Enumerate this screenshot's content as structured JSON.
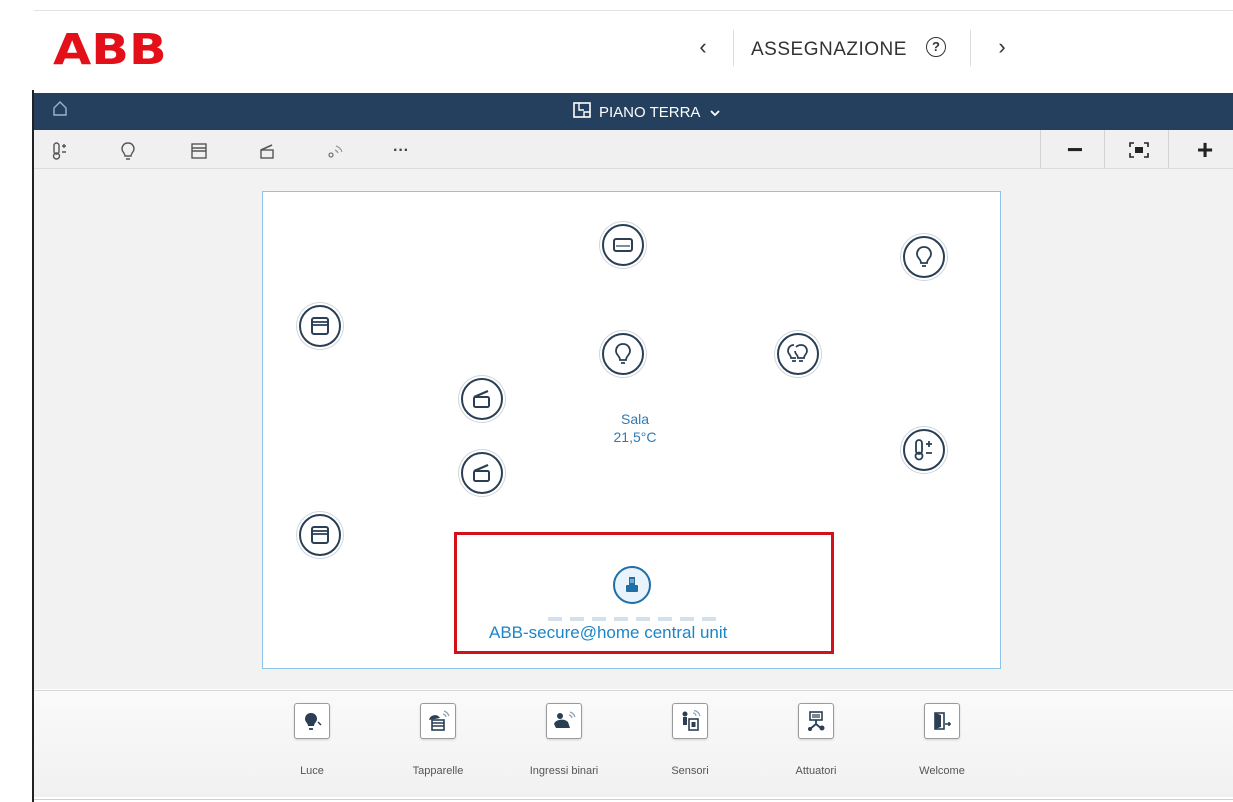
{
  "brand": {
    "logo_text": "ABB",
    "color": "#e3101a"
  },
  "header": {
    "title": "ASSEGNAZIONE",
    "prev": "‹",
    "next": "›",
    "help": "?"
  },
  "floorbar": {
    "floor_name": "PIANO TERRA",
    "bg_color": "#24405e"
  },
  "toolbar": {
    "tools": [
      "thermostat-icon",
      "bulb-icon",
      "blind-icon",
      "shutter-icon",
      "sensor-icon",
      "more-icon"
    ],
    "more_label": "···",
    "zoom_out": "−",
    "zoom_in": "+"
  },
  "plan": {
    "room_name": "Sala",
    "room_temp": "21,5°C",
    "highlight_color": "#d21218",
    "central_unit_label": "ABB-secure@home central unit"
  },
  "devices": [
    "display-icon",
    "bulb-icon",
    "blind-icon",
    "bulb-icon",
    "double-bulb-icon",
    "shutter-icon",
    "thermostat-icon",
    "shutter-icon",
    "blind-icon",
    "central-unit-icon"
  ],
  "categories": [
    {
      "label": "Luce",
      "icon": "light-category-icon"
    },
    {
      "label": "Tapparelle",
      "icon": "blinds-category-icon"
    },
    {
      "label": "Ingressi binari",
      "icon": "binary-inputs-category-icon"
    },
    {
      "label": "Sensori",
      "icon": "sensors-category-icon"
    },
    {
      "label": "Attuatori",
      "icon": "actuators-category-icon"
    },
    {
      "label": "Welcome",
      "icon": "welcome-category-icon"
    }
  ]
}
